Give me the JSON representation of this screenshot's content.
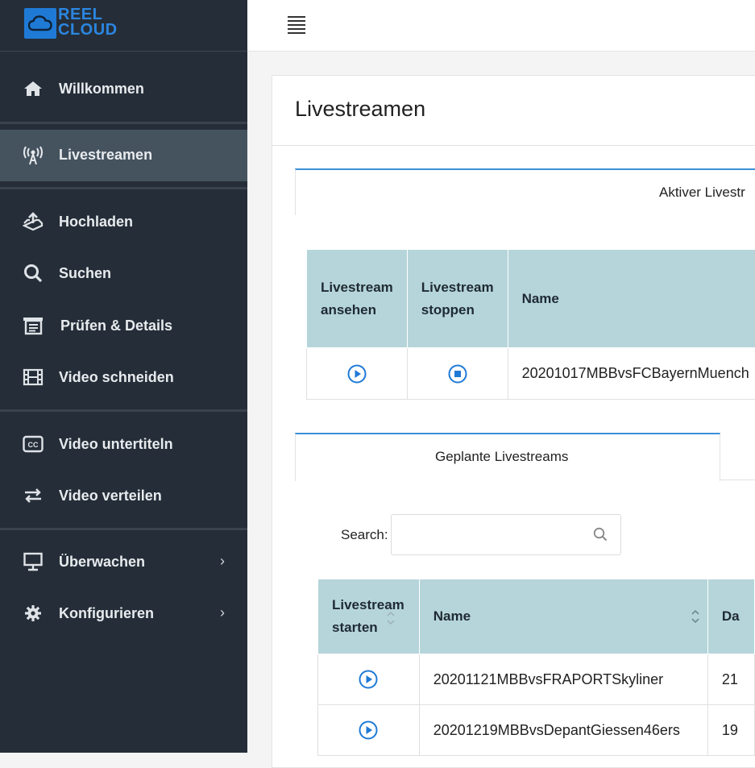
{
  "brand": {
    "line1": "REEL",
    "line2": "CLOUD"
  },
  "sidebar": {
    "items": [
      {
        "label": "Willkommen",
        "icon": "home-icon"
      },
      {
        "label": "Livestreamen",
        "icon": "broadcast-tower-icon",
        "active": true
      },
      {
        "label": "Hochladen",
        "icon": "upload-tray-icon"
      },
      {
        "label": "Suchen",
        "icon": "search-icon"
      },
      {
        "label": "Prüfen & Details",
        "icon": "clipboard-list-icon"
      },
      {
        "label": "Video schneiden",
        "icon": "film-icon"
      },
      {
        "label": "Video untertiteln",
        "icon": "closed-captions-icon"
      },
      {
        "label": "Video verteilen",
        "icon": "exchange-arrows-icon"
      },
      {
        "label": "Überwachen",
        "icon": "monitor-icon",
        "chevron": "›"
      },
      {
        "label": "Konfigurieren",
        "icon": "gear-icon",
        "chevron": "›"
      }
    ]
  },
  "main": {
    "title": "Livestreamen",
    "active_tab": "Aktiver Livestr",
    "active_table": {
      "headers": [
        "Livestream ansehen",
        "Livestream stoppen",
        "Name"
      ],
      "rows": [
        {
          "name": "20201017MBBvsFCBayernMuench"
        }
      ]
    },
    "scheduled_tab": "Geplante Livestreams",
    "search": {
      "label": "Search:",
      "placeholder": ""
    },
    "scheduled_table": {
      "headers": [
        "Livestream starten",
        "Name",
        "Da"
      ],
      "rows": [
        {
          "name": "20201121MBBvsFRAPORTSkyliner",
          "date": "21"
        },
        {
          "name": "20201219MBBvsDepantGiessen46ers",
          "date": "19"
        }
      ]
    }
  },
  "colors": {
    "sidebar_bg": "#252e38",
    "accent": "#1f7ad6",
    "header_bg": "#b5d5da",
    "tab_accent": "#3a8fd8"
  }
}
